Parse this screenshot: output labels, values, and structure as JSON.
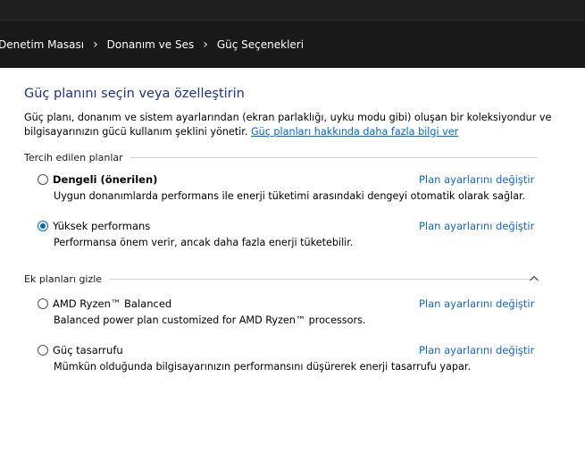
{
  "breadcrumb": {
    "items": [
      "Denetim Masası",
      "Donanım ve Ses",
      "Güç Seçenekleri"
    ],
    "separator": "›"
  },
  "page": {
    "title": "Güç planını seçin veya özelleştirin",
    "description_line1": "Güç planı, donanım ve sistem ayarlarından (ekran parlaklığı, uyku modu gibi) oluşan bir koleksiyondur ve",
    "description_line2": "bilgisayarınızın gücü kullanım şeklini yönetir. ",
    "learn_more_link": "Güç planları hakkında daha fazla bilgi ver"
  },
  "preferred": {
    "label": "Tercih edilen planlar",
    "plans": [
      {
        "name": "Dengeli (önerilen)",
        "description": "Uygun donanımlarda performans ile enerji tüketimi arasındaki dengeyi otomatik olarak sağlar.",
        "link": "Plan ayarlarını değiştir",
        "selected": false
      },
      {
        "name": "Yüksek performans",
        "description": "Performansa önem verir, ancak daha fazla enerji tüketebilir.",
        "link": "Plan ayarlarını değiştir",
        "selected": true
      }
    ]
  },
  "additional": {
    "label": "Ek planları gizle",
    "icon": "chevron-up-icon",
    "plans": [
      {
        "name": "AMD Ryzen™ Balanced",
        "description": "Balanced power plan customized for AMD Ryzen™ processors.",
        "link": "Plan ayarlarını değiştir",
        "selected": false
      },
      {
        "name": "Güç tasarrufu",
        "description": "Mümkün olduğunda bilgisayarınızın performansını düşürerek enerji tasarrufu yapar.",
        "link": "Plan ayarlarını değiştir",
        "selected": false
      }
    ]
  },
  "colors": {
    "title": "#1e3287",
    "link": "#1565c0",
    "radio_selected": "#0067c0",
    "address_bar_bg": "#191919"
  }
}
